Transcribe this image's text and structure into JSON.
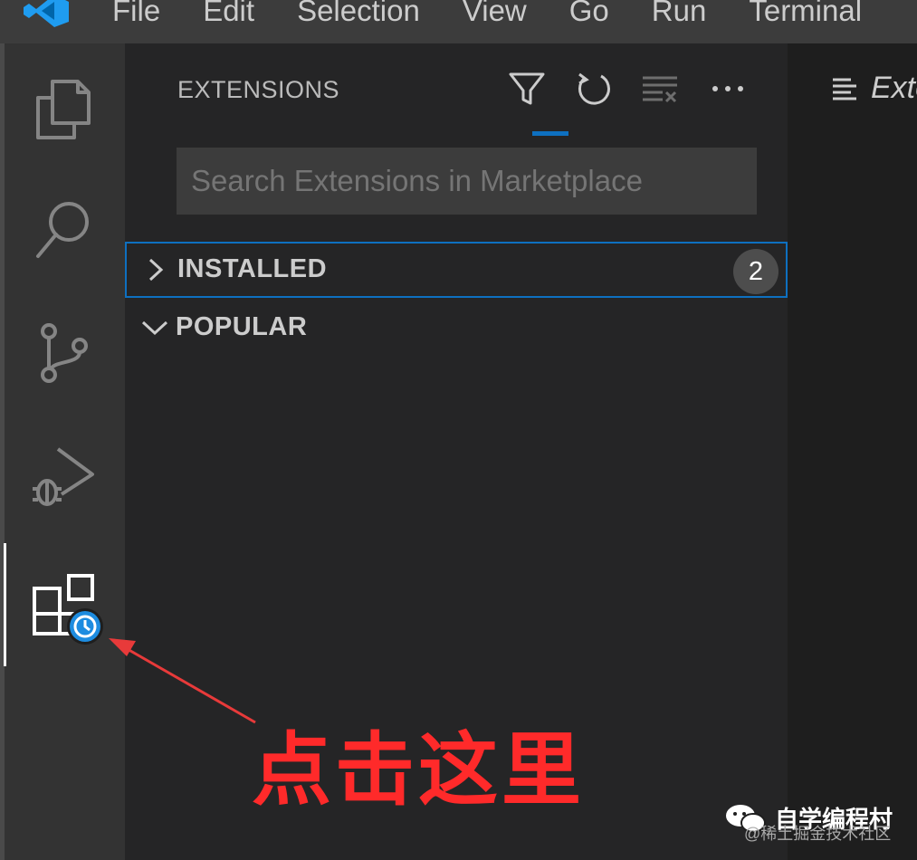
{
  "menu": {
    "items": [
      "File",
      "Edit",
      "Selection",
      "View",
      "Go",
      "Run",
      "Terminal"
    ]
  },
  "activity_bar": {
    "items": [
      {
        "icon": "explorer-icon"
      },
      {
        "icon": "search-icon"
      },
      {
        "icon": "source-control-icon"
      },
      {
        "icon": "run-debug-icon"
      },
      {
        "icon": "extensions-icon",
        "active": true
      }
    ]
  },
  "sidebar": {
    "title": "EXTENSIONS",
    "actions": [
      "filter-icon",
      "refresh-icon",
      "clear-icon",
      "more-icon"
    ],
    "search": {
      "placeholder": "Search Extensions in Marketplace",
      "value": ""
    },
    "sections": [
      {
        "label": "INSTALLED",
        "expanded": false,
        "badge": "2",
        "focused": true
      },
      {
        "label": "POPULAR",
        "expanded": true
      }
    ]
  },
  "editor": {
    "tab_label": "Exte"
  },
  "annotation": {
    "text": "点击这里",
    "color": "#ff2a2a"
  },
  "watermark": {
    "title": "自学编程村",
    "subtitle": "@稀土掘金技术社区"
  },
  "colors": {
    "accent": "#0e70c0",
    "badge_bg": "#4d4d4d",
    "activity_bg": "#333333",
    "sidebar_bg": "#252526",
    "titlebar_bg": "#3c3c3c"
  }
}
